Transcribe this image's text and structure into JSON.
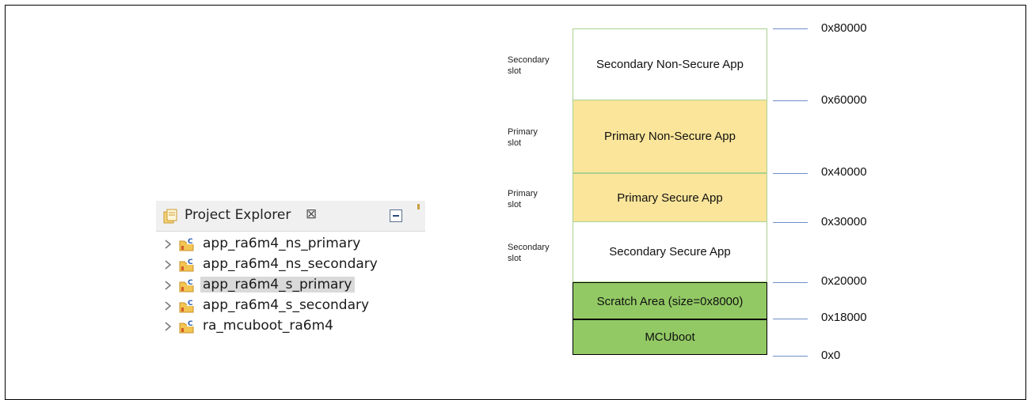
{
  "project_explorer": {
    "title": "Project Explorer",
    "close_glyph": "⊠",
    "icons": {
      "header": "project-explorer-icon",
      "collapse": "collapse-all-icon",
      "project": "c-project-folder-icon",
      "expand": "chevron-right-icon"
    },
    "items": [
      {
        "label": "app_ra6m4_ns_primary",
        "selected": false
      },
      {
        "label": "app_ra6m4_ns_secondary",
        "selected": false
      },
      {
        "label": "app_ra6m4_s_primary",
        "selected": true
      },
      {
        "label": "app_ra6m4_s_secondary",
        "selected": false
      },
      {
        "label": "ra_mcuboot_ra6m4",
        "selected": false
      }
    ]
  },
  "memory_map": {
    "colors": {
      "white_block": "#ffffff",
      "yellow_block": "#fbe59a",
      "green_block": "#92c964",
      "border_light": "#a9d18e",
      "border_dark": "#000000",
      "tick": "#6d8fc6"
    },
    "blocks": [
      {
        "label": "Secondary Non-Secure App",
        "slot": "Secondary\nslot",
        "color": "white"
      },
      {
        "label": "Primary Non-Secure App",
        "slot": "Primary\nslot",
        "color": "yellow"
      },
      {
        "label": "Primary Secure App",
        "slot": "Primary\nslot",
        "color": "yellow"
      },
      {
        "label": "Secondary Secure App",
        "slot": "Secondary\nslot",
        "color": "white"
      },
      {
        "label": "Scratch Area (size=0x8000)",
        "slot": "",
        "color": "green"
      },
      {
        "label": "MCUboot",
        "slot": "",
        "color": "green"
      }
    ],
    "addresses": [
      "0x80000",
      "0x60000",
      "0x40000",
      "0x30000",
      "0x20000",
      "0x18000",
      "0x0"
    ]
  }
}
